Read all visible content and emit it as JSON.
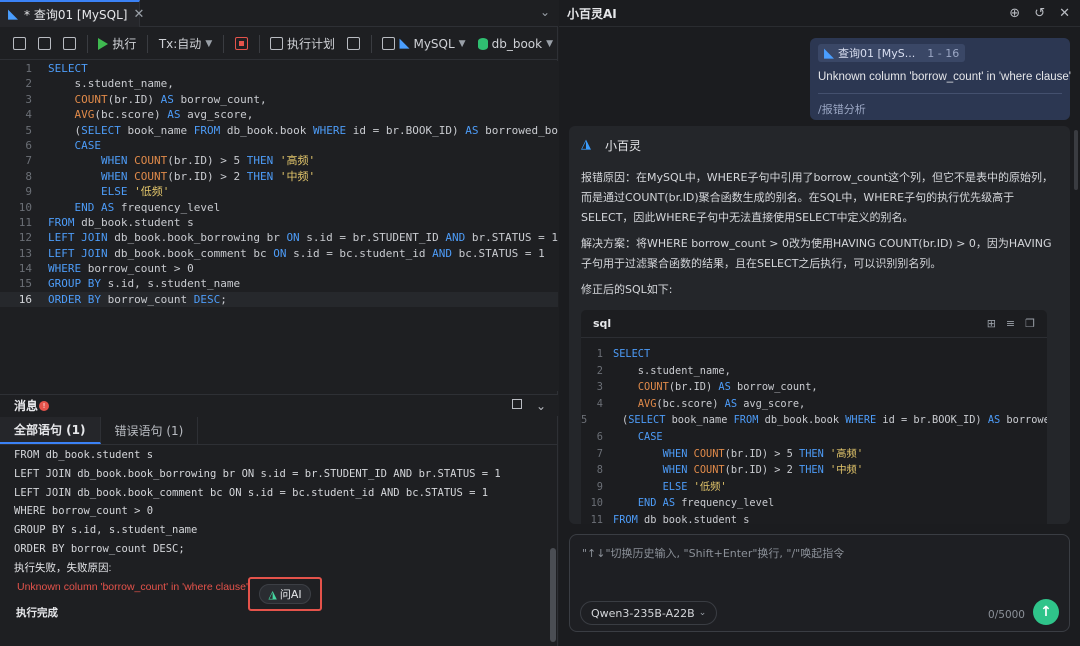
{
  "left": {
    "tab": {
      "title": "* 查询01 [MySQL]"
    },
    "toolbar": {
      "run": "执行",
      "tx_mode": "Tx:自动",
      "explain": "执行计划",
      "db_type": "MySQL",
      "database": "db_book"
    },
    "editor": {
      "lines": [
        "SELECT",
        "    s.student_name,",
        "    COUNT(br.ID) AS borrow_count,",
        "    AVG(bc.score) AS avg_score,",
        "    (SELECT book_name FROM db_book.book WHERE id = br.BOOK_ID) AS borrowed_book,",
        "    CASE",
        "        WHEN COUNT(br.ID) > 5 THEN '高频'",
        "        WHEN COUNT(br.ID) > 2 THEN '中频'",
        "        ELSE '低频'",
        "    END AS frequency_level",
        "FROM db_book.student s",
        "LEFT JOIN db_book.book_borrowing br ON s.id = br.STUDENT_ID AND br.STATUS = 1",
        "LEFT JOIN db_book.book_comment bc ON s.id = bc.student_id AND bc.STATUS = 1",
        "WHERE borrow_count > 0",
        "GROUP BY s.id, s.student_name",
        "ORDER BY borrow_count DESC;"
      ],
      "active_line": 16
    },
    "messages": {
      "title": "消息",
      "tab_all": "全部语句 (1)",
      "tab_error": "错误语句 (1)",
      "log_lines": [
        "FROM db_book.student s",
        "LEFT JOIN db_book.book_borrowing br ON s.id = br.STUDENT_ID AND br.STATUS = 1",
        "LEFT JOIN db_book.book_comment bc ON s.id = bc.student_id AND bc.STATUS = 1",
        "WHERE borrow_count > 0",
        "GROUP BY s.id, s.student_name",
        "ORDER BY borrow_count DESC;"
      ],
      "fail_label": "执行失败，失败原因:",
      "error_text": "Unknown column 'borrow_count' in 'where clause'",
      "ask_ai": "问AI",
      "done": "执行完成"
    }
  },
  "right": {
    "title": "小百灵AI",
    "user_message": {
      "ref_label": "查询01 [MyS...",
      "ref_range": "1 - 16",
      "text": "Unknown column 'borrow_count' in 'where clause'",
      "command": "/报错分析"
    },
    "ai_message": {
      "name": "小百灵",
      "para1": "报错原因：在MySQL中，WHERE子句中引用了borrow_count这个列，但它不是表中的原始列，而是通过COUNT(br.ID)聚合函数生成的别名。在SQL中，WHERE子句的执行优先级高于SELECT，因此WHERE子句中无法直接使用SELECT中定义的别名。",
      "para2": "解决方案：将WHERE borrow_count > 0改为使用HAVING COUNT(br.ID) > 0，因为HAVING子句用于过滤聚合函数的结果，且在SELECT之后执行，可以识别别名列。",
      "para3": "修正后的SQL如下:",
      "code_lang": "sql",
      "code_lines": [
        "SELECT",
        "    s.student_name,",
        "    COUNT(br.ID) AS borrow_count,",
        "    AVG(bc.score) AS avg_score,",
        "    (SELECT book_name FROM db_book.book WHERE id = br.BOOK_ID) AS borrowed_book,",
        "    CASE",
        "        WHEN COUNT(br.ID) > 5 THEN '高频'",
        "        WHEN COUNT(br.ID) > 2 THEN '中频'",
        "        ELSE '低频'",
        "    END AS frequency_level",
        "FROM db_book.student s"
      ]
    },
    "input": {
      "placeholder": "\"↑↓\"切换历史输入, \"Shift+Enter\"换行, \"/\"唤起指令",
      "model": "Qwen3-235B-A22B",
      "counter": "0/5000"
    }
  },
  "colors": {
    "keyword": "#4d9cf8",
    "function": "#e08a4a",
    "string": "#e3c66b",
    "error": "#e5534b",
    "send": "#2fc48a"
  }
}
